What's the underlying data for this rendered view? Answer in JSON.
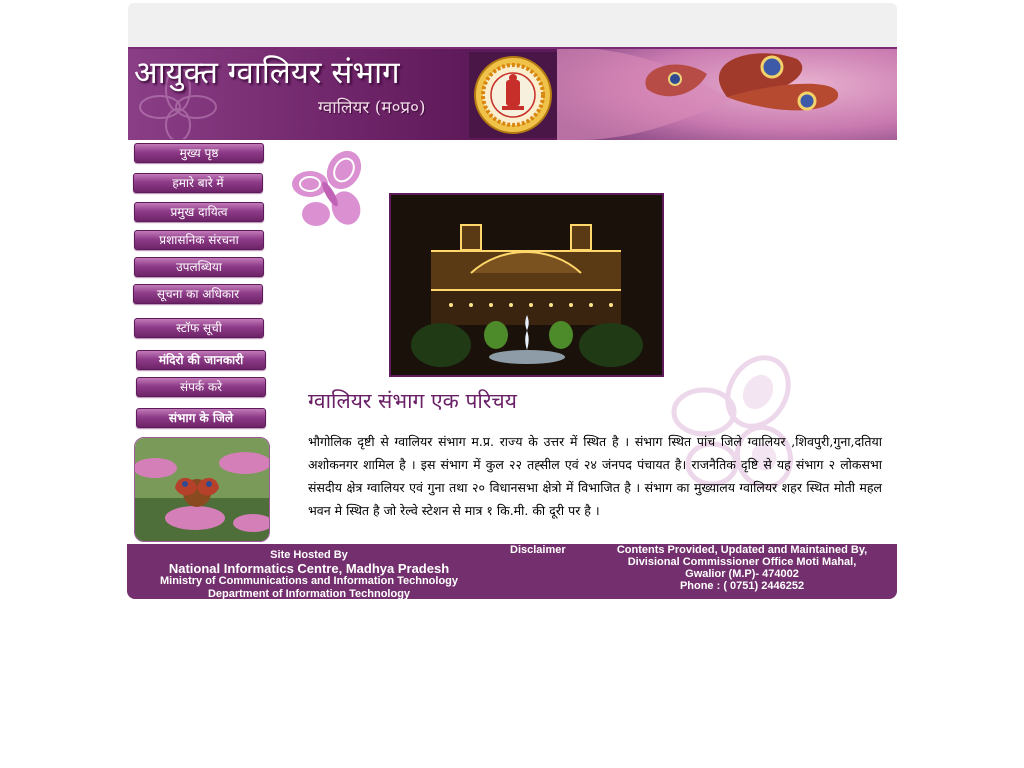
{
  "header": {
    "title": "आयुक्त ग्वालियर संभाग",
    "subtitle": "ग्वालियर (म०प्र०)"
  },
  "nav": {
    "items": [
      "मुख्य पृष्ठ",
      "हमारे बारे में",
      "प्रमुख दायित्व",
      "प्रशासनिक संरचना",
      "उपलब्धिया",
      "सूचना का अधिकार",
      "स्टॉफ सूची",
      "मंदिरो की जानकारी",
      "संपर्क करे",
      "संभाग के जिले"
    ]
  },
  "main": {
    "heading": "ग्वालियर संभाग एक परिचय",
    "paragraph": "भौगोलिक दृष्टी से ग्वालियर संभाग म.प्र. राज्य के उत्तर में स्थित है । संभाग स्थित पांच जिले ग्वालियर ,शिवपुरी,गुना,दतिया अशोकनगर शामिल है । इस संभाग में कुल २२ तह्सील एवं २४ जंनपद पंचायत है। राजनैतिक दृष्टि से यह संभाग २ लोकसभा संसदीय क्षेत्र ग्वालियर एवं गुना तथा २० विधानसभा क्षेत्रो में विभाजित है । संभाग का मुख्यालय ग्वालियर शहर स्थित मोती महल भवन मे स्थित है जो रेल्वे स्टेशन से मात्र १ कि.मी. की दूरी पर है ।"
  },
  "footer": {
    "hosted_label": "Site Hosted By",
    "nic": "National Informatics Centre",
    "state": "Madhya Pradesh",
    "ministry": "Ministry of Communications and Information Technology",
    "department": "Department of Information Technology",
    "disclaimer": "Disclaimer",
    "contents_line": "Contents Provided, Updated and Maintained By,",
    "office": "Divisional Commissioner Office Moti Mahal,",
    "address": "Gwalior (M.P)- 474002",
    "phone": "Phone : ( 0751) 2446252"
  },
  "colors": {
    "brand_purple": "#74306e",
    "heading_purple": "#6a2066"
  },
  "icons": {
    "emblem": "mp-state-emblem-icon",
    "butterfly": "butterfly-icon"
  }
}
